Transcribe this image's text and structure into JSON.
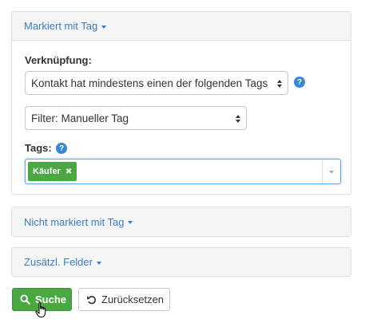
{
  "tagged_section": {
    "header": "Markiert mit Tag",
    "link_label": "Verknüpfung:",
    "link_select_value": "Kontakt hat mindestens einen der folgenden Tags",
    "filter_select_value": "Filter: Manueller Tag",
    "tags_label": "Tags:",
    "help_glyph": "?",
    "selected_tags": [
      {
        "label": "Käufer",
        "remove_glyph": "✖"
      }
    ]
  },
  "not_tagged_section": {
    "header": "Nicht markiert mit Tag"
  },
  "extra_fields_section": {
    "header": "Zusätzl. Felder"
  },
  "actions": {
    "search_label": "Suche",
    "reset_label": "Zurücksetzen"
  },
  "colors": {
    "link_blue": "#3a7cc3",
    "success_green": "#4aa843",
    "help_blue": "#3a87d6"
  },
  "icons": {
    "search": "search-icon",
    "reset": "undo-icon",
    "help": "help-icon",
    "caret": "caret-down-icon",
    "cursor": "hand-pointer-cursor"
  }
}
